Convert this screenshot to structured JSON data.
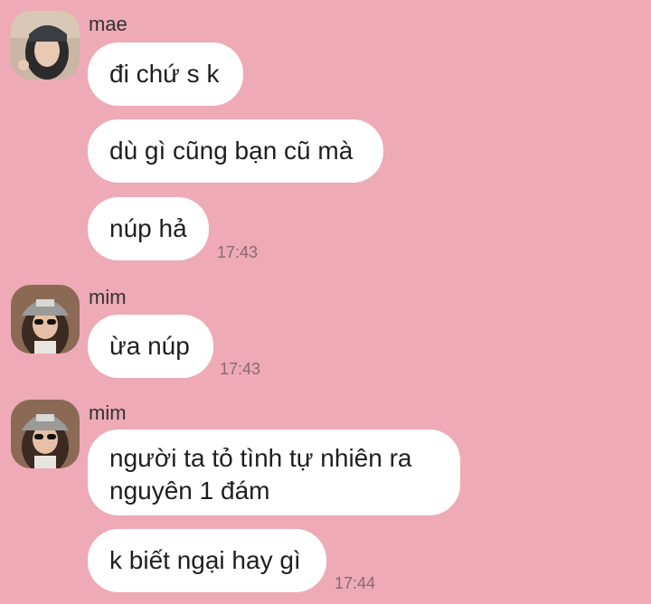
{
  "messages": [
    {
      "sender": "mae",
      "bubbles": [
        {
          "text": "đi chứ s k"
        },
        {
          "text": "dù gì cũng bạn cũ mà"
        },
        {
          "text": "núp hả",
          "time": "17:43"
        }
      ]
    },
    {
      "sender": "mim",
      "bubbles": [
        {
          "text": "ừa núp",
          "time": "17:43"
        }
      ]
    },
    {
      "sender": "mim",
      "bubbles": [
        {
          "line1": "người ta tỏ tình tự nhiên ra",
          "line2": "nguyên 1 đám"
        },
        {
          "text": "k biết ngại hay gì",
          "time": "17:44"
        }
      ]
    }
  ]
}
